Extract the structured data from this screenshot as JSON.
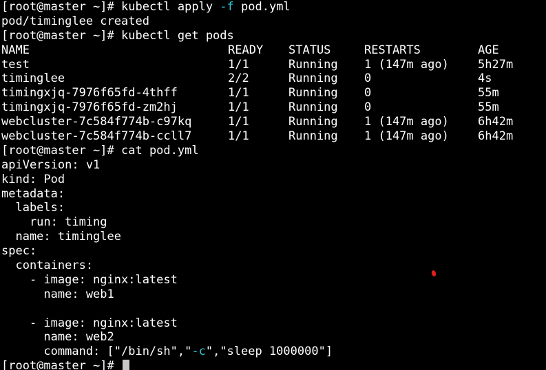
{
  "terminal": {
    "prompt": "[root@master ~]# ",
    "cmd1_pre": "kubectl apply ",
    "cmd1_flag": "-f",
    "cmd1_post": " pod.yml",
    "out1": "pod/timinglee created",
    "cmd2": "kubectl get pods",
    "table": {
      "headers": [
        "NAME",
        "READY",
        "STATUS",
        "RESTARTS",
        "AGE"
      ],
      "rows": [
        [
          "test",
          "1/1",
          "Running",
          "1 (147m ago)",
          "5h27m"
        ],
        [
          "timinglee",
          "2/2",
          "Running",
          "0",
          "4s"
        ],
        [
          "timingxjq-7976f65fd-4thff",
          "1/1",
          "Running",
          "0",
          "55m"
        ],
        [
          "timingxjq-7976f65fd-zm2hj",
          "1/1",
          "Running",
          "0",
          "55m"
        ],
        [
          "webcluster-7c584f774b-c97kq",
          "1/1",
          "Running",
          "1 (147m ago)",
          "6h42m"
        ],
        [
          "webcluster-7c584f774b-ccll7",
          "1/1",
          "Running",
          "1 (147m ago)",
          "6h42m"
        ]
      ]
    },
    "cmd3": "cat pod.yml",
    "yaml": {
      "l1": "apiVersion: v1",
      "l2": "kind: Pod",
      "l3": "metadata:",
      "l4": "  labels:",
      "l5": "    run: timing",
      "l6": "  name: timinglee",
      "l7": "spec:",
      "l8": "  containers:",
      "l9": "    - image: nginx:latest",
      "l10": "      name: web1",
      "l11": "    - image: nginx:latest",
      "l12": "      name: web2",
      "l13_pre": "      command: [\"/bin/sh\",\"",
      "l13_flag": "-c",
      "l13_post": "\",\"sleep 1000000\"]"
    },
    "final_prompt": "[root@master ~]# "
  },
  "colors": {
    "background": "#000000",
    "foreground": "#ffffff",
    "flag": "#2ec5d3",
    "marker": "#e0201a"
  }
}
